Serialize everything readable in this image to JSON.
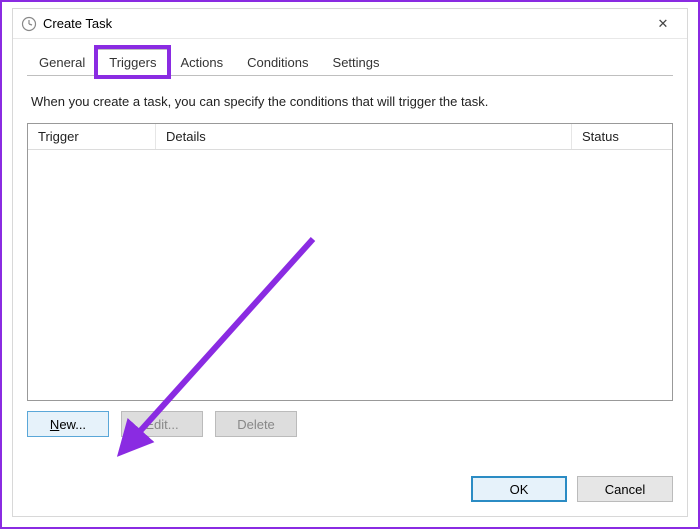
{
  "window": {
    "title": "Create Task",
    "close_label": "✕"
  },
  "tabs": {
    "general": "General",
    "triggers": "Triggers",
    "actions": "Actions",
    "conditions": "Conditions",
    "settings": "Settings"
  },
  "description": "When you create a task, you can specify the conditions that will trigger the task.",
  "table": {
    "headers": {
      "trigger": "Trigger",
      "details": "Details",
      "status": "Status"
    }
  },
  "buttons": {
    "new_prefix": "N",
    "new_rest": "ew...",
    "edit": "Edit...",
    "delete": "Delete",
    "ok": "OK",
    "cancel": "Cancel"
  }
}
